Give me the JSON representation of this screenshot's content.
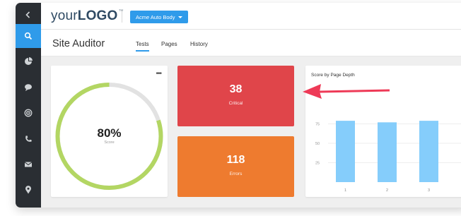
{
  "header": {
    "logo_prefix": "your",
    "logo_main": "LOGO",
    "logo_tm": "™",
    "account_label": "Acme Auto Body"
  },
  "page": {
    "title": "Site Auditor",
    "tabs": [
      {
        "label": "Tests",
        "active": true
      },
      {
        "label": "Pages",
        "active": false
      },
      {
        "label": "History",
        "active": false
      }
    ]
  },
  "sidebar": {
    "items": [
      {
        "icon": "chevron-left-icon",
        "active": false
      },
      {
        "icon": "search-icon",
        "active": true
      },
      {
        "icon": "pie-chart-icon",
        "active": false
      },
      {
        "icon": "chat-bubble-icon",
        "active": false
      },
      {
        "icon": "target-icon",
        "active": false
      },
      {
        "icon": "phone-icon",
        "active": false
      },
      {
        "icon": "envelope-icon",
        "active": false
      },
      {
        "icon": "map-pin-icon",
        "active": false
      }
    ]
  },
  "score": {
    "value": "80%",
    "label": "Score",
    "fraction": 0.8,
    "menu": "•••"
  },
  "stats": {
    "critical": {
      "value": "38",
      "label": "Critical"
    },
    "errors": {
      "value": "118",
      "label": "Errors"
    }
  },
  "colors": {
    "accent": "#2f9bea",
    "sidebar": "#2a2e33",
    "critical": "#e0454a",
    "errors": "#ee7b2f",
    "score_ring": "#b3d663",
    "score_track": "#e2e2e2",
    "bar": "#85cdfb",
    "arrow": "#ee3a57"
  },
  "chart_data": {
    "type": "bar",
    "title": "Score by Page Depth",
    "categories": [
      "1",
      "2",
      "3",
      "4"
    ],
    "values": [
      79,
      77,
      79,
      78
    ],
    "yticks": [
      25,
      50,
      75
    ],
    "ylim": [
      0,
      100
    ],
    "grid": true
  }
}
